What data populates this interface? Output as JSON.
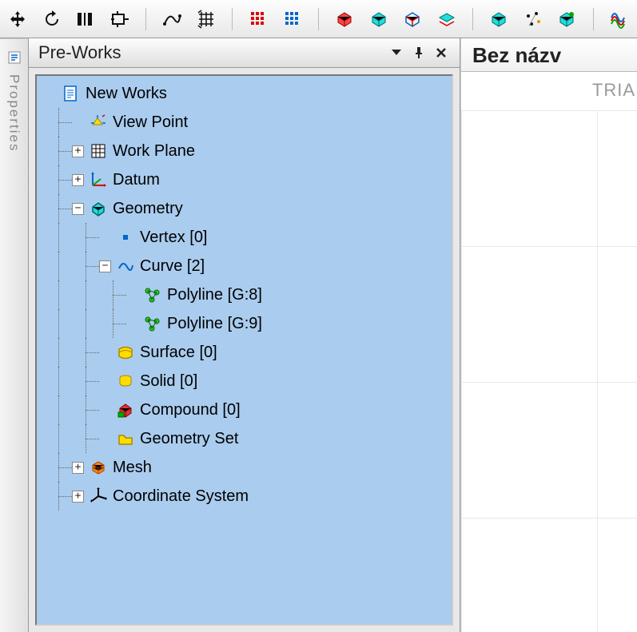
{
  "panel": {
    "title": "Pre-Works"
  },
  "sideTab": {
    "label": "Properties"
  },
  "rightPanel": {
    "title": "Bez názv",
    "subtitle": "TRIA"
  },
  "toolbar_icons": [
    "move-icon",
    "rotate-icon",
    "flip-icon",
    "offset-icon",
    "curve-icon",
    "grid-icon",
    "matrix-red-icon",
    "matrix-blue-icon",
    "box-red-icon",
    "box-cyan-icon",
    "shape1-icon",
    "shape2-icon",
    "box-green-icon",
    "dots-icon",
    "box-red2-icon",
    "wave-icon"
  ],
  "tree": [
    {
      "depth": 0,
      "expander": "none",
      "label": "New Works",
      "icon": "doc-icon"
    },
    {
      "depth": 1,
      "expander": "none",
      "label": "View Point",
      "icon": "viewpoint-icon"
    },
    {
      "depth": 1,
      "expander": "plus",
      "label": "Work Plane",
      "icon": "grid-icon"
    },
    {
      "depth": 1,
      "expander": "plus",
      "label": "Datum",
      "icon": "datum-icon"
    },
    {
      "depth": 1,
      "expander": "minus",
      "label": "Geometry",
      "icon": "geometry-icon"
    },
    {
      "depth": 2,
      "expander": "none",
      "label": "Vertex [0]",
      "icon": "vertex-icon"
    },
    {
      "depth": 2,
      "expander": "minus",
      "label": "Curve [2]",
      "icon": "curve-icon"
    },
    {
      "depth": 3,
      "expander": "none",
      "label": "Polyline [G:8]",
      "icon": "polyline-icon"
    },
    {
      "depth": 3,
      "expander": "none",
      "label": "Polyline [G:9]",
      "icon": "polyline-icon"
    },
    {
      "depth": 2,
      "expander": "none",
      "label": "Surface [0]",
      "icon": "surface-icon"
    },
    {
      "depth": 2,
      "expander": "none",
      "label": "Solid [0]",
      "icon": "solid-icon"
    },
    {
      "depth": 2,
      "expander": "none",
      "label": "Compound [0]",
      "icon": "compound-icon"
    },
    {
      "depth": 2,
      "expander": "none",
      "label": "Geometry Set",
      "icon": "folder-icon"
    },
    {
      "depth": 1,
      "expander": "plus",
      "label": "Mesh",
      "icon": "mesh-icon"
    },
    {
      "depth": 1,
      "expander": "plus",
      "label": "Coordinate System",
      "icon": "coord-icon"
    }
  ]
}
